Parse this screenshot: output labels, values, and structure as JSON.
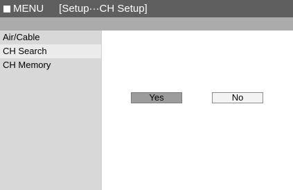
{
  "header": {
    "menu_label": "MENU",
    "breadcrumb": "[Setup···CH Setup]"
  },
  "sidebar": {
    "items": [
      {
        "label": "Air/Cable",
        "selected": false
      },
      {
        "label": "CH Search",
        "selected": true
      },
      {
        "label": "CH Memory",
        "selected": false
      }
    ]
  },
  "dialog": {
    "yes_label": "Yes",
    "no_label": "No",
    "focused": "Yes"
  },
  "colors": {
    "header_bg": "#5f5f5f",
    "subbar_bg": "#ababab",
    "sidebar_bg": "#d8d8d8",
    "selected_item_bg": "#ebebeb",
    "focused_button_bg": "#9c9c9c"
  },
  "icons": {
    "menu_marker": "square-icon"
  }
}
